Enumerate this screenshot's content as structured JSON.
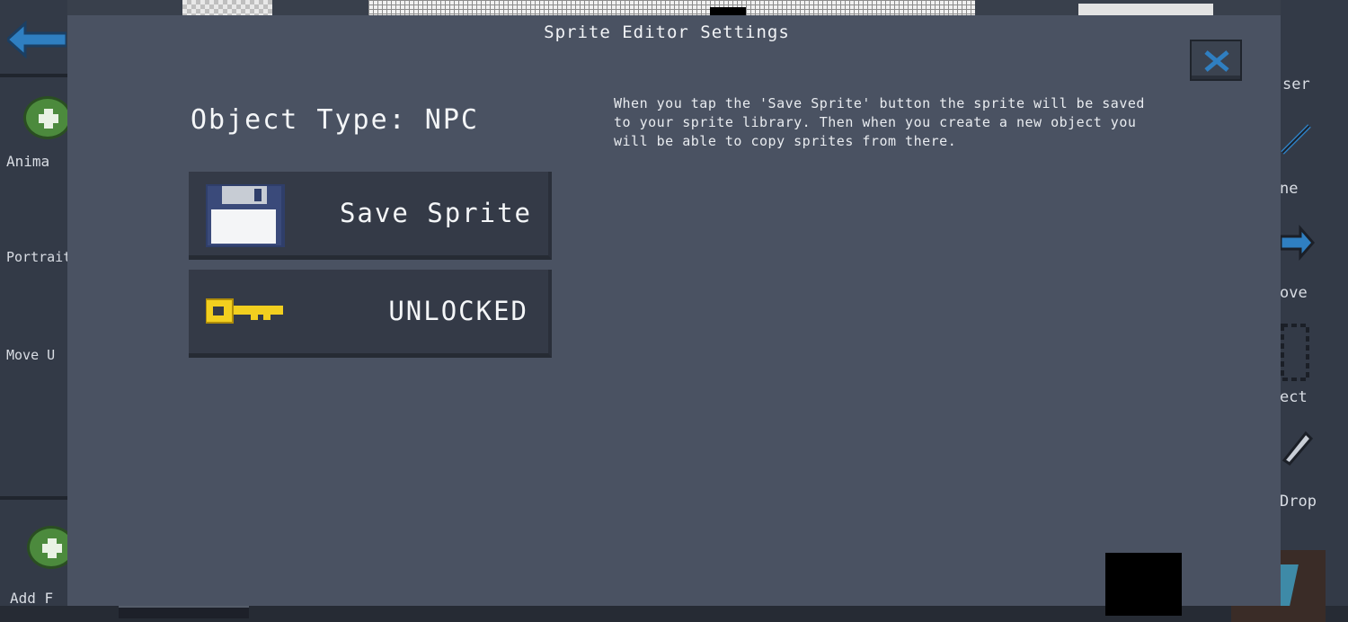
{
  "background": {
    "left_panel": {
      "labels": [
        "Anima",
        "Portrait",
        "Move U",
        "Add F"
      ]
    },
    "right_panel": {
      "labels": [
        "ser",
        "ne",
        "ove",
        "ect",
        "Drop"
      ]
    }
  },
  "dialog": {
    "title": "Sprite Editor Settings",
    "object_type_label": "Object Type: NPC",
    "save_button": {
      "label": "Save Sprite",
      "icon": "floppy-disk-icon"
    },
    "lock_button": {
      "label": "UNLOCKED",
      "icon": "key-icon"
    },
    "info_text": "When you tap the 'Save Sprite' button the sprite will be saved to your sprite library. Then when you create a new object you will be able to copy sprites from there.",
    "close_icon": "close-icon"
  },
  "colors": {
    "dialog_bg": "#4a5262",
    "button_bg": "#343a47",
    "accent_blue": "#2f7fc1",
    "key_yellow": "#f2cf1f"
  }
}
